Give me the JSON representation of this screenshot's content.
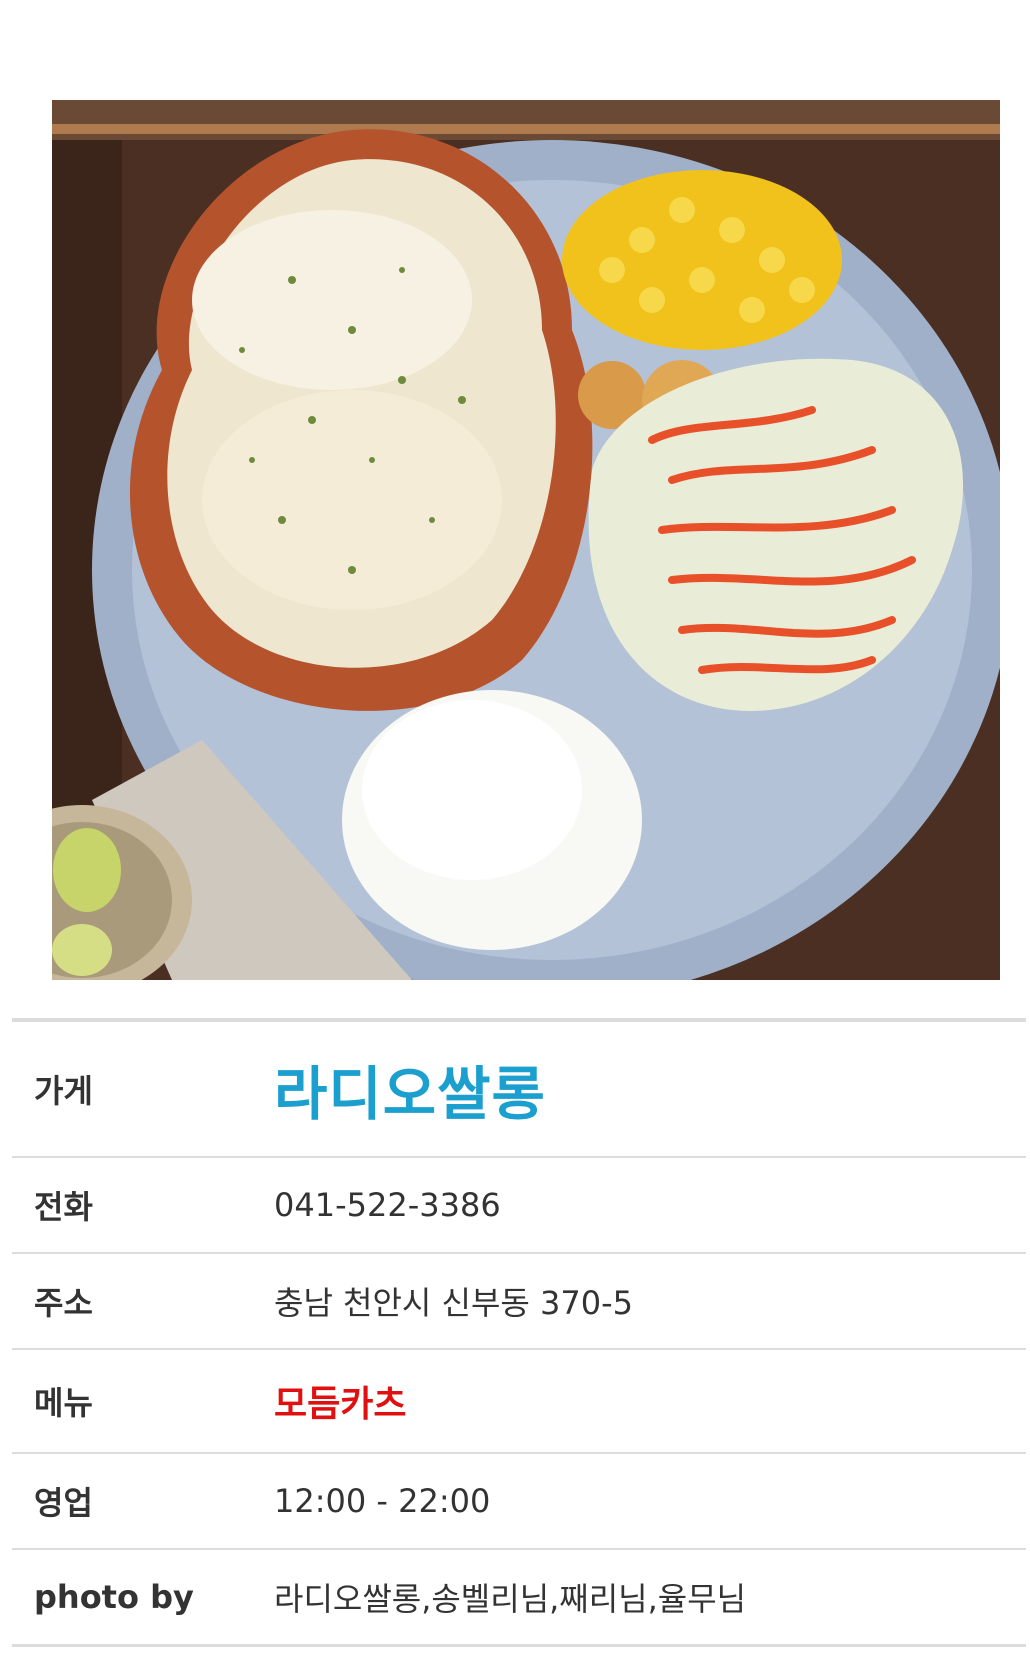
{
  "photo": {
    "alt": "모듬카츠 food photo",
    "icon": "food-plate-image"
  },
  "info": {
    "store": {
      "label": "가게",
      "value": "라디오쌀롱"
    },
    "phone": {
      "label": "전화",
      "value": "041-522-3386"
    },
    "address": {
      "label": "주소",
      "value": "충남 천안시 신부동 370-5"
    },
    "menu": {
      "label": "메뉴",
      "value": "모듬카츠"
    },
    "hours": {
      "label": "영업",
      "value": "12:00 - 22:00"
    },
    "photo_by": {
      "label": "photo by",
      "value": "라디오쌀롱,송벨리님,째리님,율무님"
    }
  },
  "colors": {
    "store_name": "#1a9fcf",
    "menu_name": "#e01010",
    "divider": "#dcdcdc"
  }
}
